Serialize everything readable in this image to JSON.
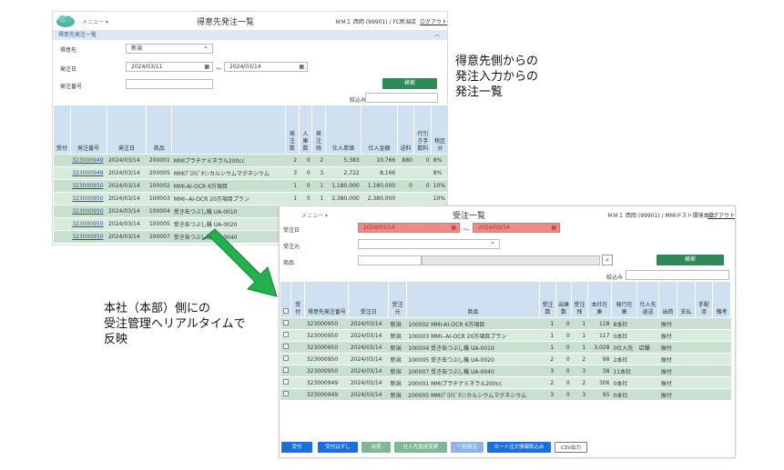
{
  "win1": {
    "menu": "メニュー ▾",
    "title": "得意先発注一覧",
    "user": "ＭＭＩ 西岡 (99901) / FC新潟店",
    "logout": "ログアウト",
    "breadcrumb": "得意先発注一覧",
    "filters": {
      "customer_label": "得意先",
      "customer_value": "新潟",
      "date_label": "発注日",
      "date_from": "2024/03/11",
      "date_sep": "～",
      "date_to": "2024/03/14",
      "order_no_label": "発注番号",
      "order_no_value": ""
    },
    "search_button": "検索",
    "narrow_label": "絞込み",
    "columns": [
      "受付",
      "発注番号",
      "発注日",
      "商品",
      "",
      "発注数",
      "入庫数",
      "発注残",
      "仕入単価",
      "仕入金額",
      "送料",
      "代引き手数料",
      "税区分"
    ],
    "rows": [
      [
        "",
        "323000949",
        "2024/03/14",
        "200001",
        "MMIプラチナミネラル200cc",
        "2",
        "0",
        "2",
        "5,383",
        "10,766",
        "880",
        "0",
        "8%"
      ],
      [
        "",
        "323000949",
        "2024/03/14",
        "200005",
        "MMIﾌﾟﾛﾃﾋﾟﾀﾐﾝカルシウムマグネシウム",
        "3",
        "0",
        "3",
        "2,722",
        "8,166",
        "",
        "",
        "8%"
      ],
      [
        "",
        "323000950",
        "2024/03/14",
        "100002",
        "MMI-AI-OCR 6万項目",
        "1",
        "0",
        "1",
        "1,180,000",
        "1,180,000",
        "0",
        "0",
        "10%"
      ],
      [
        "",
        "323000950",
        "2024/03/14",
        "100003",
        "MMI--AI-OCR 20万項目プラン",
        "1",
        "0",
        "1",
        "2,380,000",
        "2,380,000",
        "",
        "",
        "10%"
      ],
      [
        "",
        "323000950",
        "2024/03/14",
        "100004",
        "受き缶つぶし機 UA-0010",
        "",
        "",
        "",
        "",
        "",
        "",
        "",
        ""
      ],
      [
        "",
        "323000950",
        "2024/03/14",
        "100005",
        "受き缶つぶし機 UA-0020",
        "",
        "",
        "",
        "",
        "",
        "",
        "",
        ""
      ],
      [
        "",
        "323000950",
        "2024/03/14",
        "100007",
        "受き缶つぶし機 UA-0040",
        "",
        "",
        "",
        "",
        "",
        "",
        "",
        ""
      ]
    ]
  },
  "annotation_top": [
    "得意先側からの",
    "発注入力からの",
    "発注一覧"
  ],
  "annotation_bottom": [
    "本社（本部）側にの",
    "受注管理へリアルタイムで",
    "反映"
  ],
  "win2": {
    "menu": "メニュー ▾",
    "title": "受注一覧",
    "user": "ＭＭＩ 西岡 (99901) / MMIテスト環境本社",
    "logout": "ログアウト",
    "filters": {
      "date_label": "受注日",
      "date_from": "2024/03/14",
      "date_sep": "～",
      "date_to": "2024/03/14",
      "source_label": "受注元",
      "source_value": "",
      "product_label": "商品",
      "product_value": ""
    },
    "search_button": "検索",
    "narrow_label": "絞込み",
    "columns": [
      "",
      "受付",
      "得意先発注番号",
      "受注日",
      "受注元",
      "商品",
      "受注数",
      "出庫数",
      "受注残",
      "本社在庫",
      "発行在庫",
      "仕入先返送",
      "出荷",
      "支払",
      "手配済",
      "備考"
    ],
    "rows": [
      [
        "",
        "",
        "323000950",
        "2024/03/14",
        "新潟",
        "100002 MMI-AI-OCR 6万項目",
        "1",
        "0",
        "1",
        "118",
        "8本社",
        "",
        "振付",
        "",
        "",
        ""
      ],
      [
        "",
        "",
        "323000950",
        "2024/03/14",
        "新潟",
        "100003 MMI--AI-OCR 20万項目プラン",
        "1",
        "0",
        "1",
        "117",
        "0本社",
        "",
        "振付",
        "",
        "",
        ""
      ],
      [
        "",
        "",
        "323000950",
        "2024/03/14",
        "新潟",
        "100004 受き缶つぶし機 UA-0010",
        "1",
        "0",
        "1",
        "3,028",
        "0仕入先",
        "店舗",
        "振付",
        "",
        "",
        ""
      ],
      [
        "",
        "",
        "323000950",
        "2024/03/14",
        "新潟",
        "100005 受き缶つぶし機 UA-0020",
        "2",
        "0",
        "2",
        "98",
        "2本社",
        "",
        "振付",
        "",
        "",
        ""
      ],
      [
        "",
        "",
        "323000950",
        "2024/03/14",
        "新潟",
        "100007 受き缶つぶし機 UA-0040",
        "3",
        "0",
        "3",
        "38",
        "11本社",
        "",
        "振付",
        "",
        "",
        ""
      ],
      [
        "",
        "",
        "323000949",
        "2024/03/14",
        "新潟",
        "200001 MMIプラチナミネラル200cc",
        "2",
        "0",
        "2",
        "306",
        "0本社",
        "",
        "振付",
        "",
        "",
        ""
      ],
      [
        "",
        "",
        "323000949",
        "2024/03/14",
        "新潟",
        "200005 MMIﾌﾟﾛﾃﾋﾟﾀﾐﾝカルシウムマグネシウム",
        "3",
        "0",
        "3",
        "95",
        "0本社",
        "",
        "振付",
        "",
        "",
        ""
      ]
    ],
    "buttons": [
      "受付",
      "受付はずし",
      "出荷",
      "仕入先直送変更",
      "一括発注",
      "カート注文情報取込み",
      "CSV出力"
    ]
  },
  "colors": {
    "green": "#2e8b57",
    "arrow": "#22b14c",
    "header": "#cfe0f1",
    "row": "#c9dfd0",
    "blue_btn": "#1a6fe0",
    "green_btn": "#7fb79a"
  }
}
